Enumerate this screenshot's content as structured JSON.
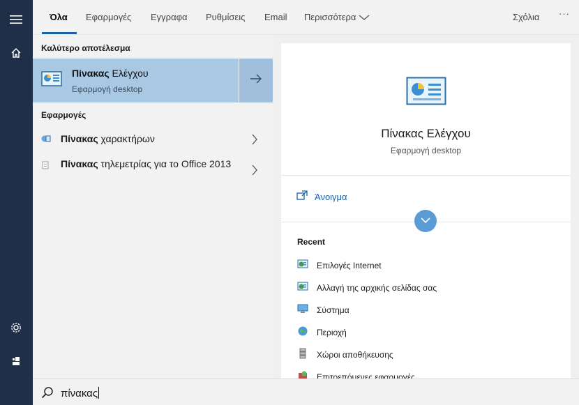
{
  "rail": {
    "icons": [
      "hamburger-icon",
      "home-icon",
      "gear-icon",
      "user-icon"
    ]
  },
  "tabs": {
    "all": "Όλα",
    "apps": "Εφαρμογές",
    "documents": "Εγγραφα",
    "settings": "Ρυθμίσεις",
    "email": "Email",
    "more": "Περισσότερα",
    "feedback": "Σχόλια",
    "options": "···"
  },
  "left": {
    "best_match_heading": "Καλύτερο αποτέλεσμα",
    "best_match": {
      "title_bold": "Πίνακας",
      "title_rest": " Ελέγχου",
      "subtitle": "Εφαρμογή desktop"
    },
    "apps_heading": "Εφαρμογές",
    "apps": [
      {
        "bold": "Πίνακας",
        "rest": " χαρακτήρων"
      },
      {
        "bold": "Πίνακας",
        "rest": " τηλεμετρίας για το Office 2013"
      }
    ]
  },
  "preview": {
    "title": "Πίνακας Ελέγχου",
    "subtitle": "Εφαρμογή desktop",
    "open_label": "Άνοιγμα",
    "recent_heading": "Recent",
    "recent": [
      "Επιλογές Internet",
      "Αλλαγή της αρχικής σελίδας σας",
      "Σύστημα",
      "Περιοχή",
      "Χώροι αποθήκευσης",
      "Επιτοεπόμενες εφαρμογές"
    ]
  },
  "search": {
    "query": "πίνακας"
  },
  "colors": {
    "rail": "#1f2f47",
    "accent": "#1b5fa8",
    "selected": "#a9c8e4",
    "expand_button": "#5b9bd5"
  }
}
